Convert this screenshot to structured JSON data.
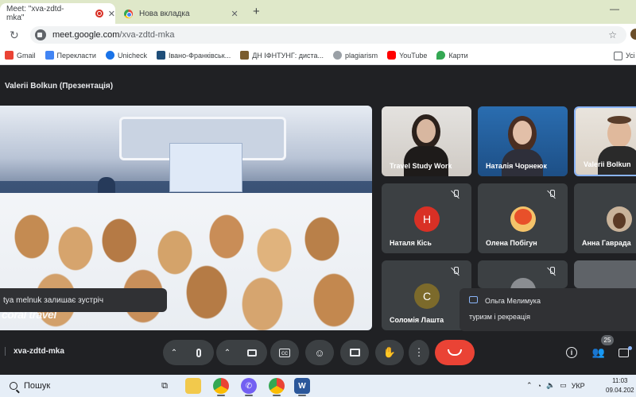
{
  "browser": {
    "tabs": [
      {
        "title": "Meet: \"xva-zdtd-mka\"",
        "active": true
      },
      {
        "title": "Нова вкладка",
        "active": false
      }
    ],
    "url_host": "meet.google.com",
    "url_path": "/xva-zdtd-mka",
    "bookmarks": [
      {
        "label": "Gmail",
        "icon": "gmail-icon",
        "color": "#ea4335"
      },
      {
        "label": "Перекласти",
        "icon": "translate-icon",
        "color": "#4285f4"
      },
      {
        "label": "Unicheck",
        "icon": "unicheck-icon",
        "color": "#1a73e8"
      },
      {
        "label": "Івано-Франківськ...",
        "icon": "bookmark-page-icon",
        "color": "#1f4e79"
      },
      {
        "label": "ДН ІФНТУНГ: диста...",
        "icon": "bookmark-page-icon",
        "color": "#7a5c2e"
      },
      {
        "label": "plagiarism",
        "icon": "bookmark-page-icon",
        "color": "#9aa0a6"
      },
      {
        "label": "YouTube",
        "icon": "youtube-icon",
        "color": "#ff0000"
      },
      {
        "label": "Карти",
        "icon": "maps-icon",
        "color": "#34a853"
      }
    ],
    "bookmarks_right": "Усі"
  },
  "meet": {
    "presenter_title": "Valerii Bolkun (Презентація)",
    "notification": "tya melnuk залишає зустріч",
    "presentation_logo": "coral travel",
    "participants": [
      {
        "name": "Travel Study Work",
        "type": "video",
        "muted": false
      },
      {
        "name": "Наталія Чорнеюк",
        "type": "video",
        "muted": false
      },
      {
        "name": "Valerii Bolkun",
        "type": "video",
        "muted": false
      },
      {
        "name": "Наталя Кісь",
        "type": "avatar",
        "initial": "Н",
        "avatar_color": "#d93025",
        "muted": true
      },
      {
        "name": "Олена Побігун",
        "type": "photo",
        "muted": true
      },
      {
        "name": "Анна Гаврада",
        "type": "photo",
        "muted": false
      },
      {
        "name": "Соломія Лашта",
        "type": "avatar",
        "initial": "С",
        "avatar_color": "#7c6a2b",
        "muted": true
      },
      {
        "name": "",
        "type": "photo",
        "muted": true
      }
    ],
    "chat_toast": {
      "from": "Ольга Мелимука",
      "text": "туризм і рекреація"
    },
    "meeting_code": "xva-zdtd-mka",
    "participant_count": "25"
  },
  "taskbar": {
    "search_label": "Пошук",
    "language": "УКР",
    "time": "11:03",
    "date": "09.04.202"
  }
}
